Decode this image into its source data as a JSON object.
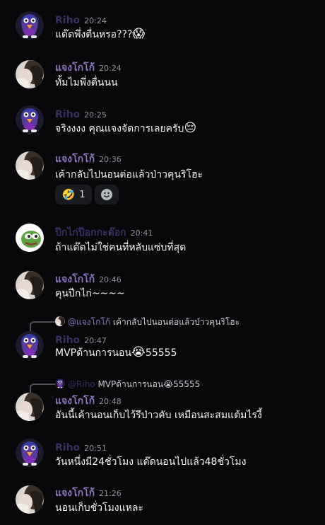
{
  "users": {
    "riho": {
      "name": "Riho",
      "color": "#3a2f62"
    },
    "jaeng": {
      "name": "แจงโกโก้",
      "color": "#8f76c5"
    },
    "pik": {
      "name": "ปีกไก่ปีอกกะต๊อก",
      "color": "#3a2f62"
    }
  },
  "messages": [
    {
      "user": "Riho",
      "time": "20:24",
      "text": "แด๊ดพึ่งตื่นหรอ???",
      "emoji": "😱"
    },
    {
      "user": "แจงโกโก้",
      "time": "20:24",
      "text": "ทั้มไมพึ่งตื่นนน",
      "emoji": ""
    },
    {
      "user": "Riho",
      "time": "20:25",
      "text": "จริงงงง คุณแจงจัดการเลยครับ",
      "emoji": "😔"
    },
    {
      "user": "แจงโกโก้",
      "time": "20:36",
      "text": "เค้ากลับไปนอนต่อแล้วป่าวคุนริโฮะ",
      "emoji": ""
    },
    {
      "user": "ปีกไก่ปีอกกะต๊อก",
      "time": "20:41",
      "text": "ถ้าแด๊ดไม่ใช่คนที่หลับแซ่บที่สุด",
      "emoji": ""
    },
    {
      "user": "แจงโกโก้",
      "time": "20:46",
      "text": "คุนปีกไก่~~~~",
      "emoji": ""
    },
    {
      "user": "Riho",
      "time": "20:47",
      "text": "MVPด้านการนอน",
      "emoji": "😭",
      "text2": "55555"
    },
    {
      "user": "แจงโกโก้",
      "time": "20:48",
      "text": "อันนี้เค้านอนเก็บไว้รึป่าวคับ เหมือนสะสมแต้มไรงี้",
      "emoji": ""
    },
    {
      "user": "Riho",
      "time": "20:51",
      "text": "วันหนึ่งมี24ชั่วโมง แด๊ดนอนไปแล้ว48ชั่วโมง",
      "emoji": ""
    },
    {
      "user": "แจงโกโก้",
      "time": "21:26",
      "text": "นอนเก็บชั่วโมงแหละ",
      "emoji": ""
    }
  ],
  "reaction": {
    "emoji": "🤣",
    "count": "1",
    "add_icon": "add-reaction-icon"
  },
  "replies": [
    {
      "name": "@แจงโกโก้",
      "text": "เค้ากลับไปนอนต่อแล้วป่าวคุนริโฮะ"
    },
    {
      "name": "@Riho",
      "text": "MVPด้านการนอน",
      "emoji": "😭",
      "text2": "55555"
    }
  ]
}
